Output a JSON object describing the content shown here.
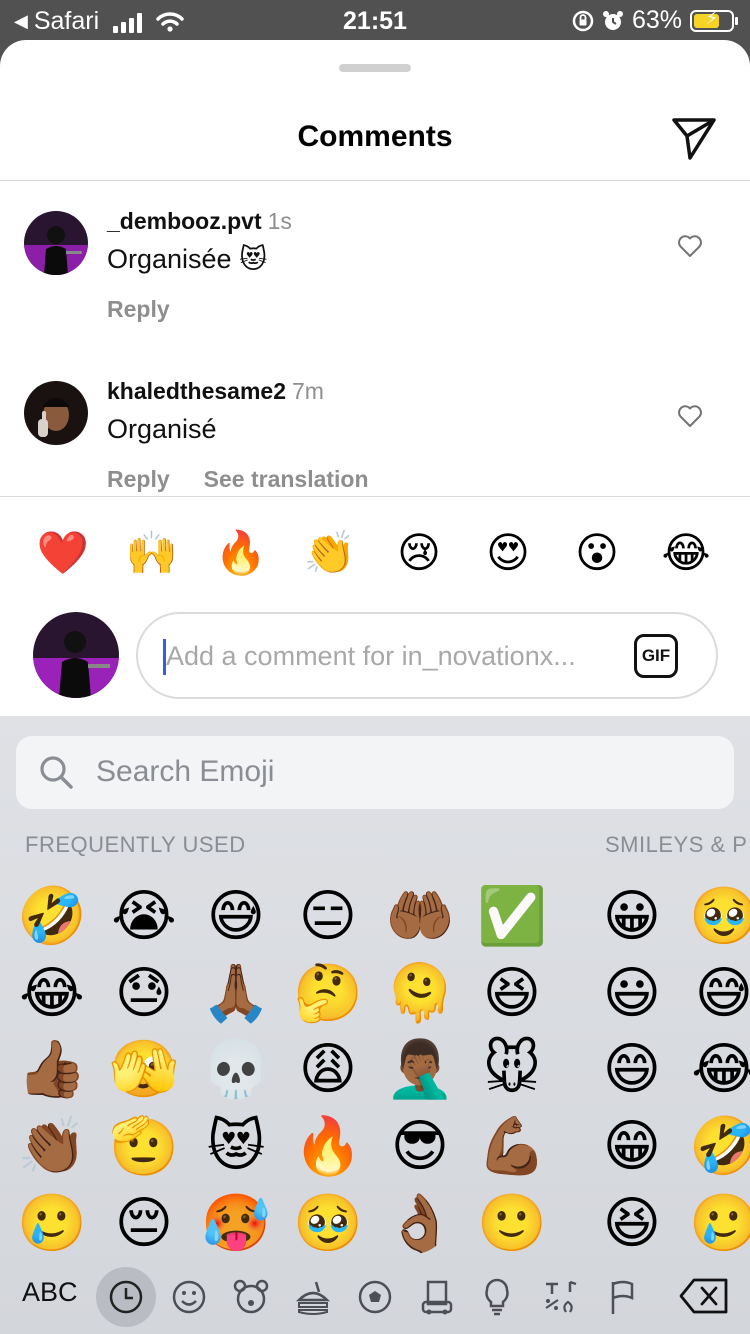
{
  "status_bar": {
    "back_app": "Safari",
    "time": "21:51",
    "battery_percent": "63%"
  },
  "sheet": {
    "title": "Comments"
  },
  "comments": [
    {
      "username": "_dembooz.pvt",
      "time": "1s",
      "text": "Organisée 😻",
      "reply": "Reply",
      "see_translation": ""
    },
    {
      "username": "khaledthesame2",
      "time": "7m",
      "text": "Organisé",
      "reply": "Reply",
      "see_translation": "See translation"
    }
  ],
  "quick_reactions": [
    "❤️",
    "🙌",
    "🔥",
    "👏",
    "😢",
    "😍",
    "😮",
    "😂"
  ],
  "composer": {
    "placeholder": "Add a comment for in_novationx...",
    "gif_label": "GIF"
  },
  "keyboard": {
    "search_placeholder": "Search Emoji",
    "section_frequently_used": "FREQUENTLY USED",
    "section_smileys": "SMILEYS & P",
    "frequently_used": [
      [
        "🤣",
        "😭",
        "😅",
        "😑",
        "🤲🏾",
        "✅"
      ],
      [
        "😂",
        "😓",
        "🙏🏾",
        "🤔",
        "🫠",
        "😆"
      ],
      [
        "👍🏾",
        "🫣",
        "💀",
        "😩",
        "🤦🏾‍♂️",
        "🐭"
      ],
      [
        "👏🏾",
        "🫡",
        "😻",
        "🔥",
        "😎",
        "💪🏾"
      ],
      [
        "🥲",
        "😔",
        "🥵",
        "🥹",
        "👌🏾",
        "🙂"
      ]
    ],
    "smileys": [
      [
        "😀",
        "🥹"
      ],
      [
        "😃",
        "😅"
      ],
      [
        "😄",
        "😂"
      ],
      [
        "😁",
        "🤣"
      ],
      [
        "😆",
        "🥲"
      ]
    ],
    "abc_label": "ABC",
    "categories": [
      "recent-clock",
      "smiley",
      "bear",
      "food",
      "ball",
      "buildings",
      "lightbulb",
      "symbols",
      "flag"
    ]
  }
}
